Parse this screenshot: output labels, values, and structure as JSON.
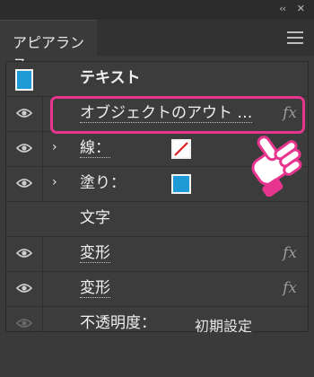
{
  "window": {
    "collapse_label": "‹‹",
    "close_label": "✕"
  },
  "panel": {
    "tab": "アピアランス",
    "menu_icon": "hamburger-icon"
  },
  "rows": {
    "header": {
      "label": "テキスト",
      "thumb_color": "#1e9ad6"
    },
    "object_effect": {
      "label": "オブジェクトのアウト …",
      "fx": "fx"
    },
    "stroke": {
      "label": "線：",
      "arrow": "›",
      "swatch_icon": "stroke-none-swatch"
    },
    "fill": {
      "label": "塗り：",
      "arrow": "›",
      "swatch_color": "#1e9ad6"
    },
    "characters": {
      "label": "文字"
    },
    "transform1": {
      "label": "変形",
      "fx": "fx"
    },
    "transform2": {
      "label": "変形",
      "fx": "fx"
    },
    "opacity": {
      "label": "不透明度：",
      "value": "初期設定"
    }
  },
  "colors": {
    "highlight": "#e7358f",
    "accent_blue": "#1e9ad6"
  }
}
